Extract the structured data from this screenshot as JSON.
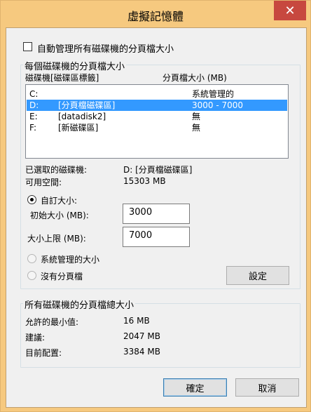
{
  "window": {
    "title": "虛擬記憶體",
    "close_glyph": "✕"
  },
  "auto_manage": {
    "label": "自動管理所有磁碟機的分頁檔大小",
    "checked": false
  },
  "per_drive_group": {
    "title": "每個磁碟機的分頁檔大小",
    "headers": {
      "drive": "磁碟機[磁碟區標籤]",
      "size": "分頁檔大小 (MB)"
    },
    "rows": [
      {
        "drive": "C:",
        "label": "",
        "size": "系統管理的",
        "selected": false
      },
      {
        "drive": "D:",
        "label": "[分頁檔磁碟區]",
        "size": "3000 - 7000",
        "selected": true
      },
      {
        "drive": "E:",
        "label": "[datadisk2]",
        "size": "無",
        "selected": false
      },
      {
        "drive": "F:",
        "label": "[新磁碟區]",
        "size": "無",
        "selected": false
      }
    ],
    "selected_drive": {
      "label": "已選取的磁碟機:",
      "value": "D:  [分頁檔磁碟區]"
    },
    "free_space": {
      "label": "可用空間:",
      "value": "15303 MB"
    },
    "custom_size": {
      "label": "自訂大小:",
      "checked": true
    },
    "initial_size": {
      "label": "初始大小 (MB):",
      "value": "3000"
    },
    "max_size": {
      "label": "大小上限 (MB):",
      "value": "7000"
    },
    "system_managed": {
      "label": "系統管理的大小",
      "checked": false
    },
    "no_paging": {
      "label": "沒有分頁檔",
      "checked": false
    },
    "set_button": "設定"
  },
  "totals_group": {
    "title": "所有磁碟機的分頁檔總大小",
    "min_allowed": {
      "label": "允許的最小值:",
      "value": "16 MB"
    },
    "recommended": {
      "label": "建議:",
      "value": "2047 MB"
    },
    "current": {
      "label": "目前配置:",
      "value": "3384 MB"
    }
  },
  "buttons": {
    "ok": "確定",
    "cancel": "取消"
  }
}
